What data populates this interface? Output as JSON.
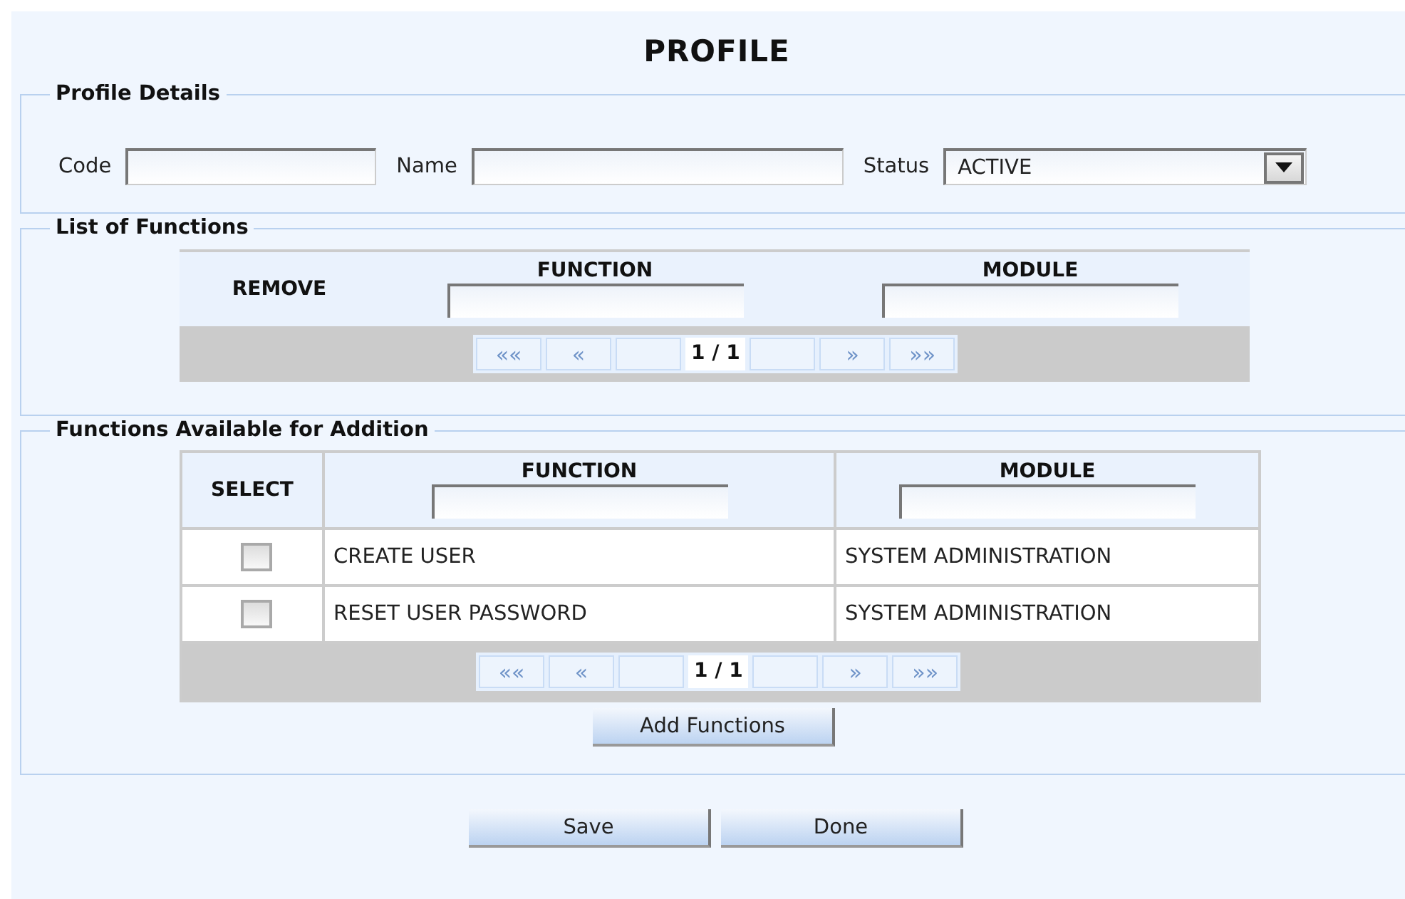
{
  "title": "PROFILE",
  "profile_details": {
    "legend": "Profile Details",
    "fields": [
      {
        "kind": "text",
        "label": "Code"
      },
      {
        "kind": "text",
        "label": "Name"
      },
      {
        "kind": "select",
        "label": "Status",
        "value": "ACTIVE"
      }
    ]
  },
  "list_of_functions": {
    "legend": "List of Functions",
    "columns": [
      {
        "label": "REMOVE",
        "filter": false
      },
      {
        "label": "FUNCTION",
        "filter": true
      },
      {
        "label": "MODULE",
        "filter": true
      }
    ],
    "pager": {
      "first": "««",
      "prev": "«",
      "page": "1 / 1",
      "next": "»",
      "last": "»»",
      "disabled": true
    }
  },
  "functions_available": {
    "legend": "Functions Available for Addition",
    "columns": [
      {
        "label": "SELECT",
        "filter": false
      },
      {
        "label": "FUNCTION",
        "filter": true
      },
      {
        "label": "MODULE",
        "filter": true
      }
    ],
    "rows": [
      {
        "checked": false,
        "function": "CREATE USER",
        "module": "SYSTEM ADMINISTRATION"
      },
      {
        "checked": false,
        "function": "RESET USER PASSWORD",
        "module": "SYSTEM ADMINISTRATION"
      }
    ],
    "pager": {
      "first": "««",
      "prev": "«",
      "page": "1 / 1",
      "next": "»",
      "last": "»»",
      "disabled": true
    },
    "button": "Add Functions"
  },
  "buttons": [
    "Save",
    "Done"
  ]
}
